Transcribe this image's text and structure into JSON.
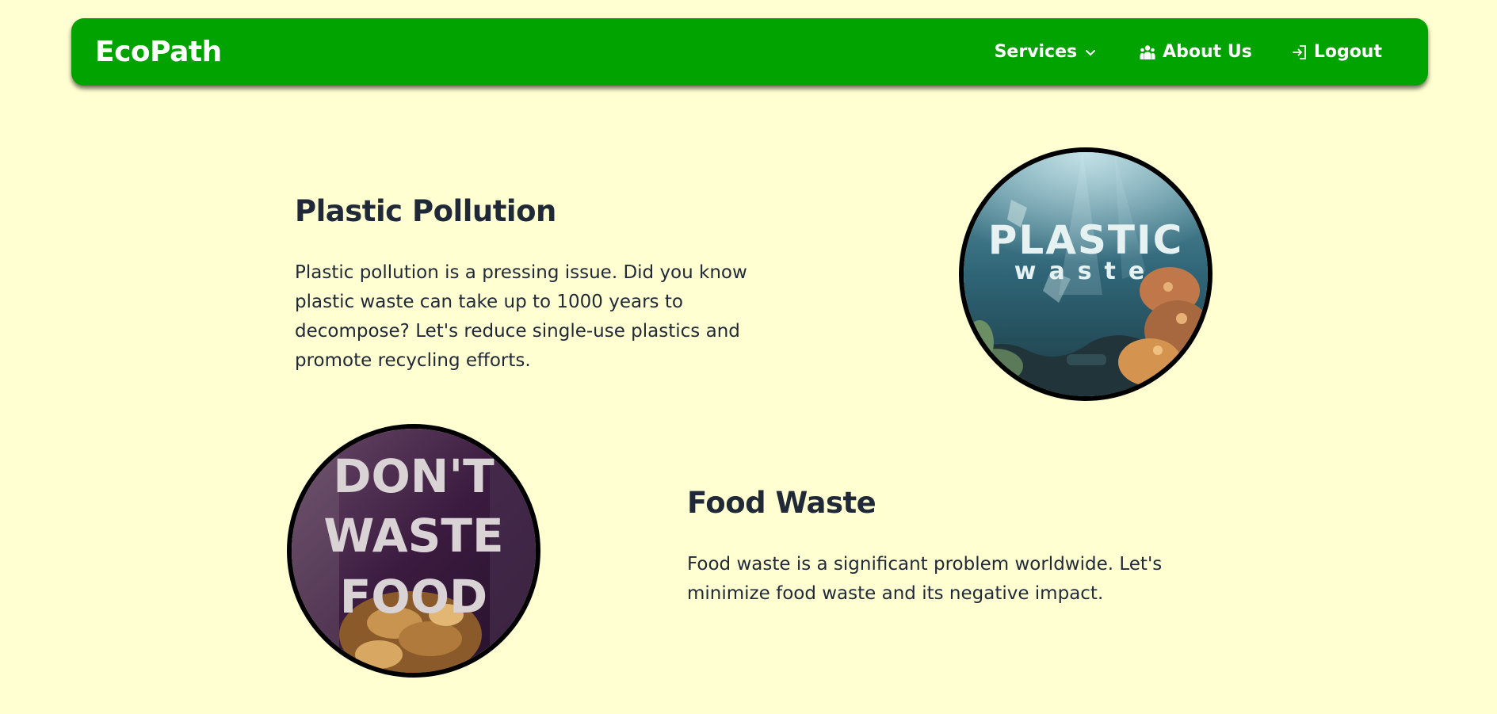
{
  "navbar": {
    "brand": "EcoPath",
    "items": [
      {
        "label": "Services",
        "icon": "chevron-down-icon"
      },
      {
        "label": "About Us",
        "icon": "users-icon"
      },
      {
        "label": "Logout",
        "icon": "logout-icon"
      }
    ],
    "background": "#00a300"
  },
  "page": {
    "background": "#ffffd1"
  },
  "sections": [
    {
      "title": "Plastic Pollution",
      "text": "Plastic pollution is a pressing issue. Did you know plastic waste can take up to 1000 years to decompose? Let's reduce single-use plastics and promote recycling efforts.",
      "image_text": [
        "PLASTIC",
        "waste"
      ]
    },
    {
      "title": "Food Waste",
      "text": "Food waste is a significant problem worldwide. Let's minimize food waste and its negative impact.",
      "image_text": [
        "DON'T",
        "WASTE",
        "FOOD"
      ]
    }
  ]
}
